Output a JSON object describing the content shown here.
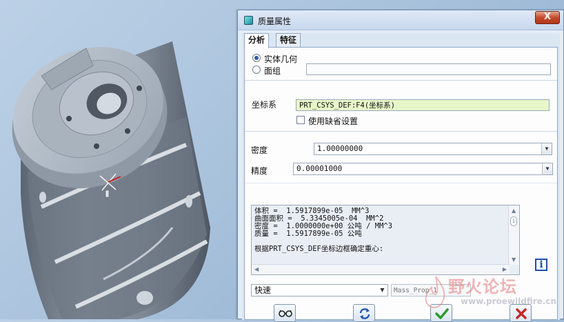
{
  "dialog": {
    "title": "质量属性",
    "close_label": "X",
    "tabs": [
      {
        "label": "分析",
        "active": true
      },
      {
        "label": "特征",
        "active": false
      }
    ],
    "geometry": {
      "solid_label": "实体几何",
      "quilt_label": "面组",
      "solid_selected": true,
      "quilt_value": ""
    },
    "csys": {
      "label": "坐标系",
      "value": "PRT_CSYS_DEF:F4(坐标系)",
      "use_default_label": "使用缺省设置",
      "use_default_checked": false
    },
    "density": {
      "label": "密度",
      "value": "1.00000000"
    },
    "accuracy": {
      "label": "精度",
      "value": "0.00001000"
    },
    "results": [
      "体积 =  1.5917899e-05  MM^3",
      "曲面面积 =  5.3345005e-04  MM^2",
      "密度 =  1.0000000e+00 公吨 / MM^3",
      "质量 =  1.5917899e-05 公吨",
      "",
      "根据PRT_CSYS_DEF坐标边框确定重心:"
    ],
    "info_icon": "i",
    "mode": {
      "value": "快速"
    },
    "param_name": {
      "placeholder": "Mass_Prop_1"
    },
    "buttons": {
      "preview_icon": "glasses-icon",
      "repeat_icon": "repeat-icon",
      "ok_icon": "checkmark-icon",
      "cancel_icon": "cancel-x-icon"
    }
  },
  "watermark": {
    "text": "野火论坛",
    "url": "www.proewildfire.cn"
  },
  "colors": {
    "dialog_bg": "#e4ecf6",
    "field_green": "#e7f6c8",
    "accent_blue": "#1c4fa8",
    "close_red": "#c44b2c"
  }
}
